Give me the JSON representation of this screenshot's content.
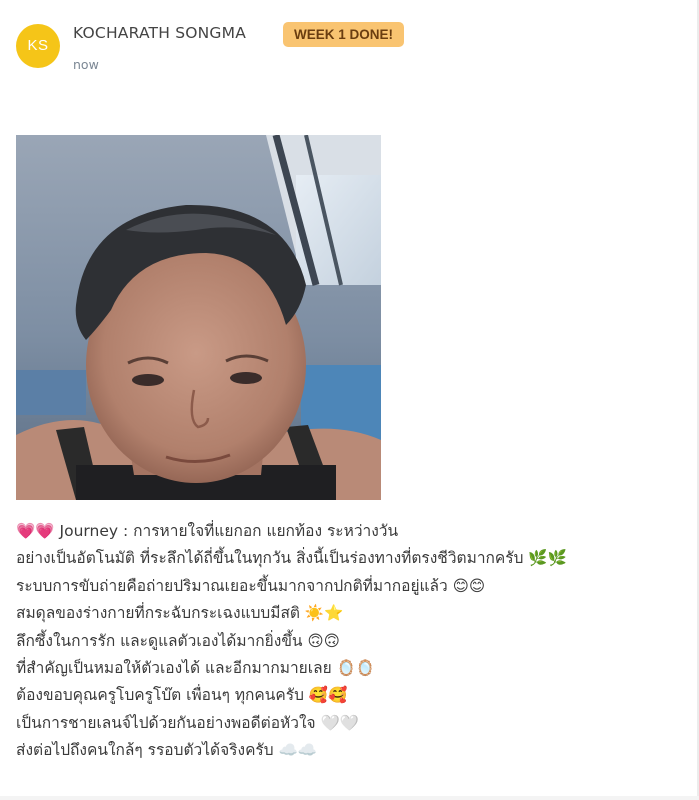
{
  "post": {
    "author": {
      "initials": "KS",
      "name": "KOCHARATH SONGMA",
      "avatar_color": "#f5c518"
    },
    "badge": {
      "label": "WEEK 1 DONE!",
      "color": "#f9c471"
    },
    "timestamp": "now",
    "photo": {
      "icon": "selfie-photo"
    },
    "body_lines": [
      "💗💗 Journey : การหายใจที่แยกอก แยกท้อง ระหว่างวัน",
      "อย่างเป็นอัตโนมัติ ที่ระลึกได้ถี่ขึ้นในทุกวัน สิ่งนี้เป็นร่องทางที่ตรงชีวิตมากครับ 🌿🌿",
      "ระบบการขับถ่ายคือถ่ายปริมาณเยอะขึ้นมากจากปกติที่มากอยู่แล้ว 😊😊",
      "สมดุลของร่างกายที่กระฉับกระเฉงแบบมีสติ ☀️⭐",
      "ลึกซึ้งในการรัก และดูแลตัวเองได้มากยิ่งขึ้น 🙃🙃",
      "ที่สำคัญเป็นหมอให้ตัวเองได้ และอีกมากมายเลย 🪞🪞",
      "ต้องขอบคุณครูโบครูโบ๊ต เพื่อนๆ ทุกคนครับ 🥰🥰",
      "เป็นการชายเลนจ์ไปด้วยกันอย่างพอดีต่อหัวใจ 🤍🤍",
      "ส่งต่อไปถึงคนใกล้ๆ รรอบตัวได้จริงครับ ☁️☁️"
    ]
  }
}
